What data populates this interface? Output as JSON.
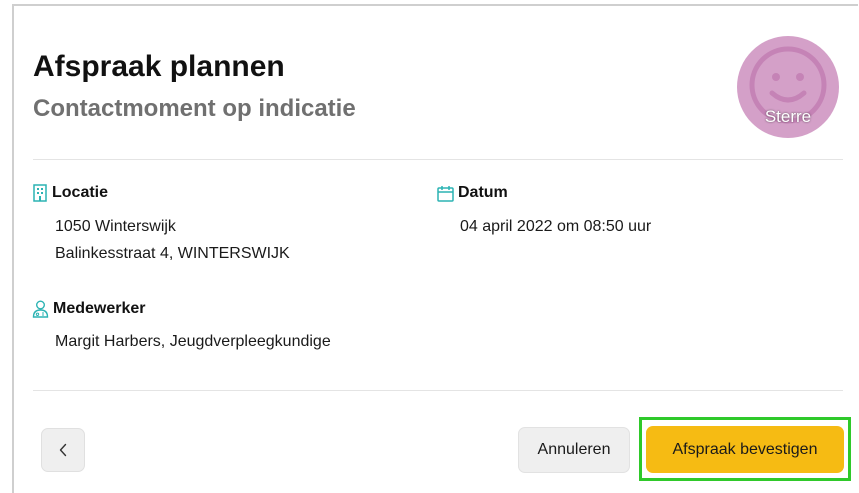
{
  "header": {
    "title": "Afspraak plannen",
    "subtitle": "Contactmoment op indicatie"
  },
  "avatar": {
    "name": "Sterre",
    "icon": "smiley-face-icon",
    "background": "#d4a0c8"
  },
  "locatie": {
    "label": "Locatie",
    "icon": "building-icon",
    "line1": "1050 Winterswijk",
    "line2": "Balinkesstraat 4, WINTERSWIJK"
  },
  "datum": {
    "label": "Datum",
    "icon": "calendar-icon",
    "value": "04 april 2022 om 08:50 uur"
  },
  "medewerker": {
    "label": "Medewerker",
    "icon": "staff-person-icon",
    "value": "Margit Harbers, Jeugdverpleegkundige"
  },
  "footer": {
    "back_icon": "chevron-left-icon",
    "cancel_label": "Annuleren",
    "confirm_label": "Afspraak bevestigen"
  },
  "colors": {
    "accent": "#f6bb13",
    "icon_teal": "#2bb3b3",
    "highlight": "#2fc92a"
  }
}
